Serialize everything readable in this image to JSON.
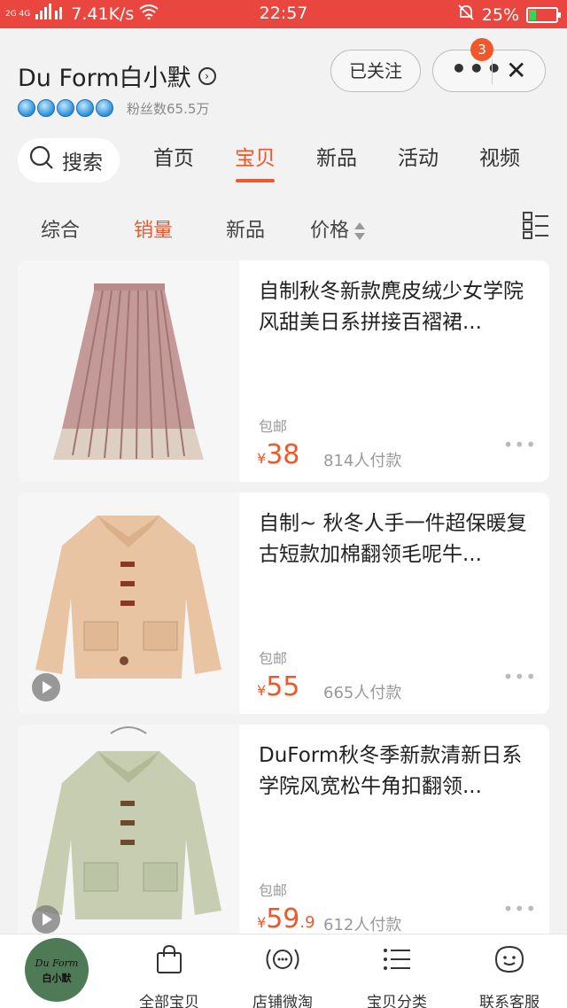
{
  "status_bar": {
    "network": "2G 4G",
    "speed": "7.41K/s",
    "time": "22:57",
    "battery": "25%",
    "battery_level": 0.25,
    "color": "#e8463f"
  },
  "shop": {
    "name": "Du Form白小默",
    "fans": "粉丝数65.5万",
    "follow_label": "已关注",
    "badge_count": "3",
    "accent": "#f0582b"
  },
  "nav": {
    "search_label": "搜索",
    "tabs": [
      "首页",
      "宝贝",
      "新品",
      "活动",
      "视频"
    ]
  },
  "sort": {
    "items": [
      "综合",
      "销量",
      "新品",
      "价格"
    ]
  },
  "products": [
    {
      "title": "自制秋冬新款麂皮绒少女学院风甜美日系拼接百褶裙...",
      "shipping": "包邮",
      "currency": "¥",
      "price_int": "38",
      "price_dec": "",
      "sold": "814人付款"
    },
    {
      "title": "自制~ 秋冬人手一件超保暖复古短款加棉翻领毛呢牛...",
      "shipping": "包邮",
      "currency": "¥",
      "price_int": "55",
      "price_dec": "",
      "sold": "665人付款"
    },
    {
      "title": "DuForm秋冬季新款清新日系学院风宽松牛角扣翻领...",
      "shipping": "包邮",
      "currency": "¥",
      "price_int": "59",
      "price_dec": ".9",
      "sold": "612人付款"
    }
  ],
  "bottom_nav": {
    "logo_line1": "Du Form",
    "logo_line2": "白小默",
    "items": [
      "全部宝贝",
      "店铺微淘",
      "宝贝分类",
      "联系客服"
    ]
  }
}
